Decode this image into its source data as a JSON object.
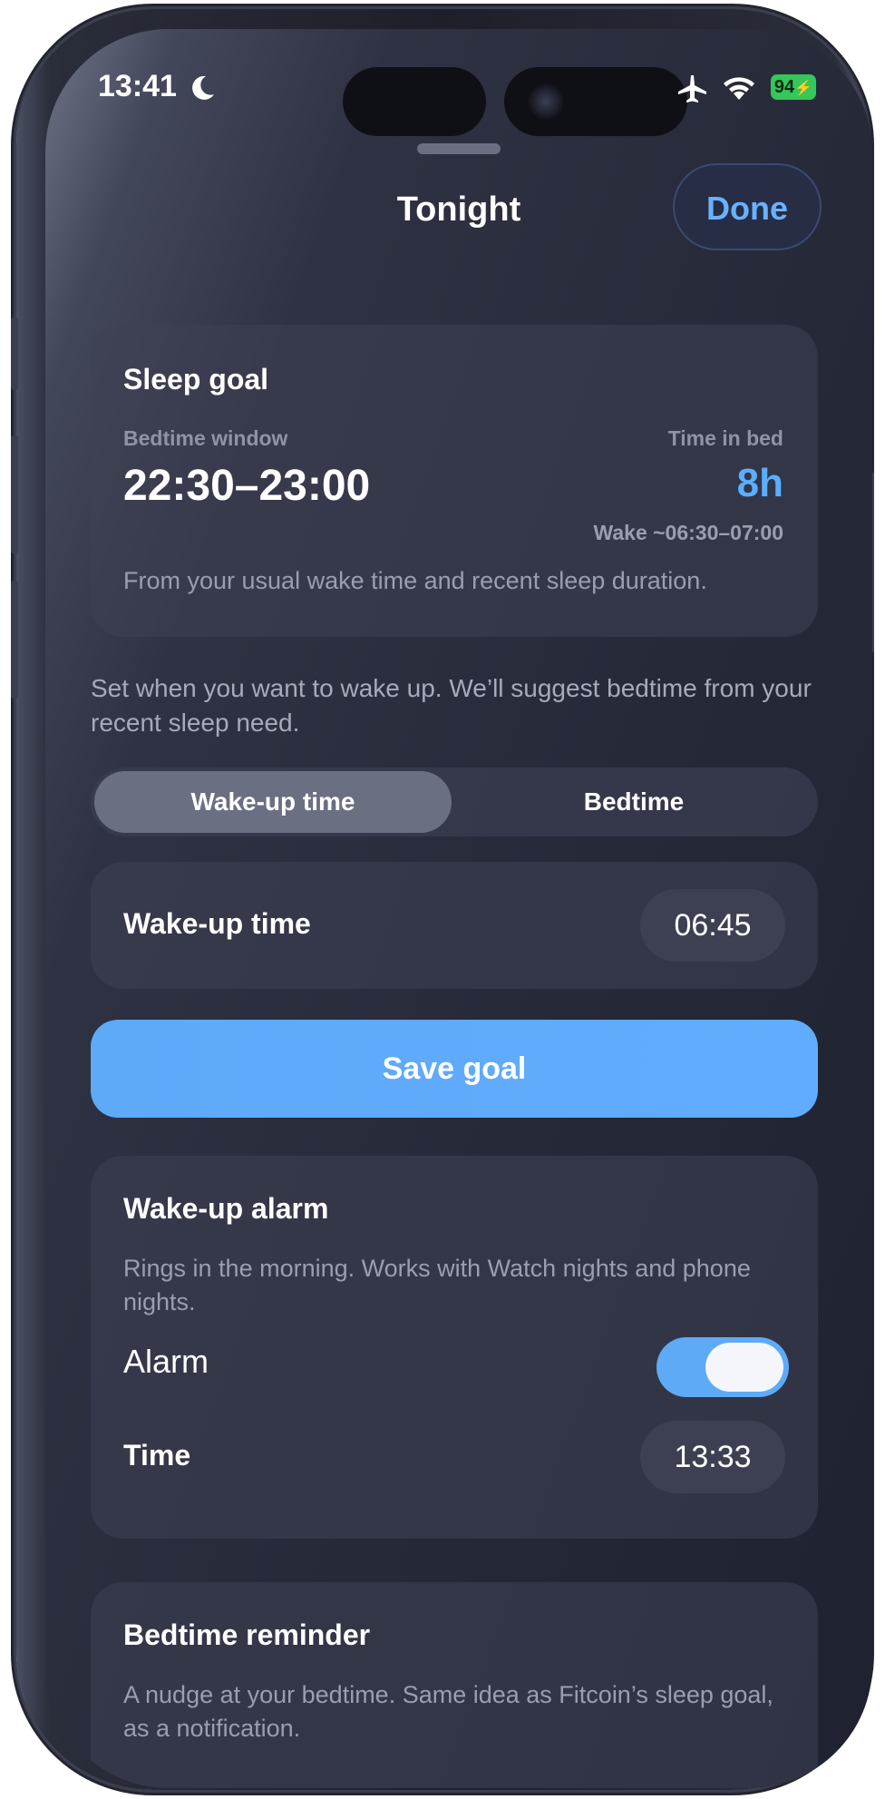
{
  "status_bar": {
    "time": "13:41",
    "battery": "94"
  },
  "sheet": {
    "title": "Tonight",
    "done_label": "Done"
  },
  "sleep_goal": {
    "title": "Sleep goal",
    "bedtime_window_label": "Bedtime window",
    "bedtime_window": "22:30–23:00",
    "time_in_bed_label": "Time in bed",
    "time_in_bed": "8h",
    "wake_range": "Wake ~06:30–07:00",
    "description": "From your usual wake time and recent sleep duration."
  },
  "intro_text": "Set when you want to wake up. We’ll suggest bedtime from your recent sleep need.",
  "segmented": {
    "options": [
      "Wake-up time",
      "Bedtime"
    ],
    "selected": "Wake-up time"
  },
  "wake_row": {
    "label": "Wake-up time",
    "value": "06:45"
  },
  "save_label": "Save goal",
  "alarm": {
    "title": "Wake-up alarm",
    "description": "Rings in the morning. Works with Watch nights and phone nights.",
    "toggle_label": "Alarm",
    "enabled": true,
    "time_label": "Time",
    "time_value": "13:33"
  },
  "reminder": {
    "title": "Bedtime reminder",
    "description": "A nudge at your bedtime. Same idea as Fitcoin’s sleep goal, as a notification."
  },
  "colors": {
    "accent": "#5aaeff",
    "toggle_on": "#5eaaf7",
    "battery": "#35c759"
  }
}
